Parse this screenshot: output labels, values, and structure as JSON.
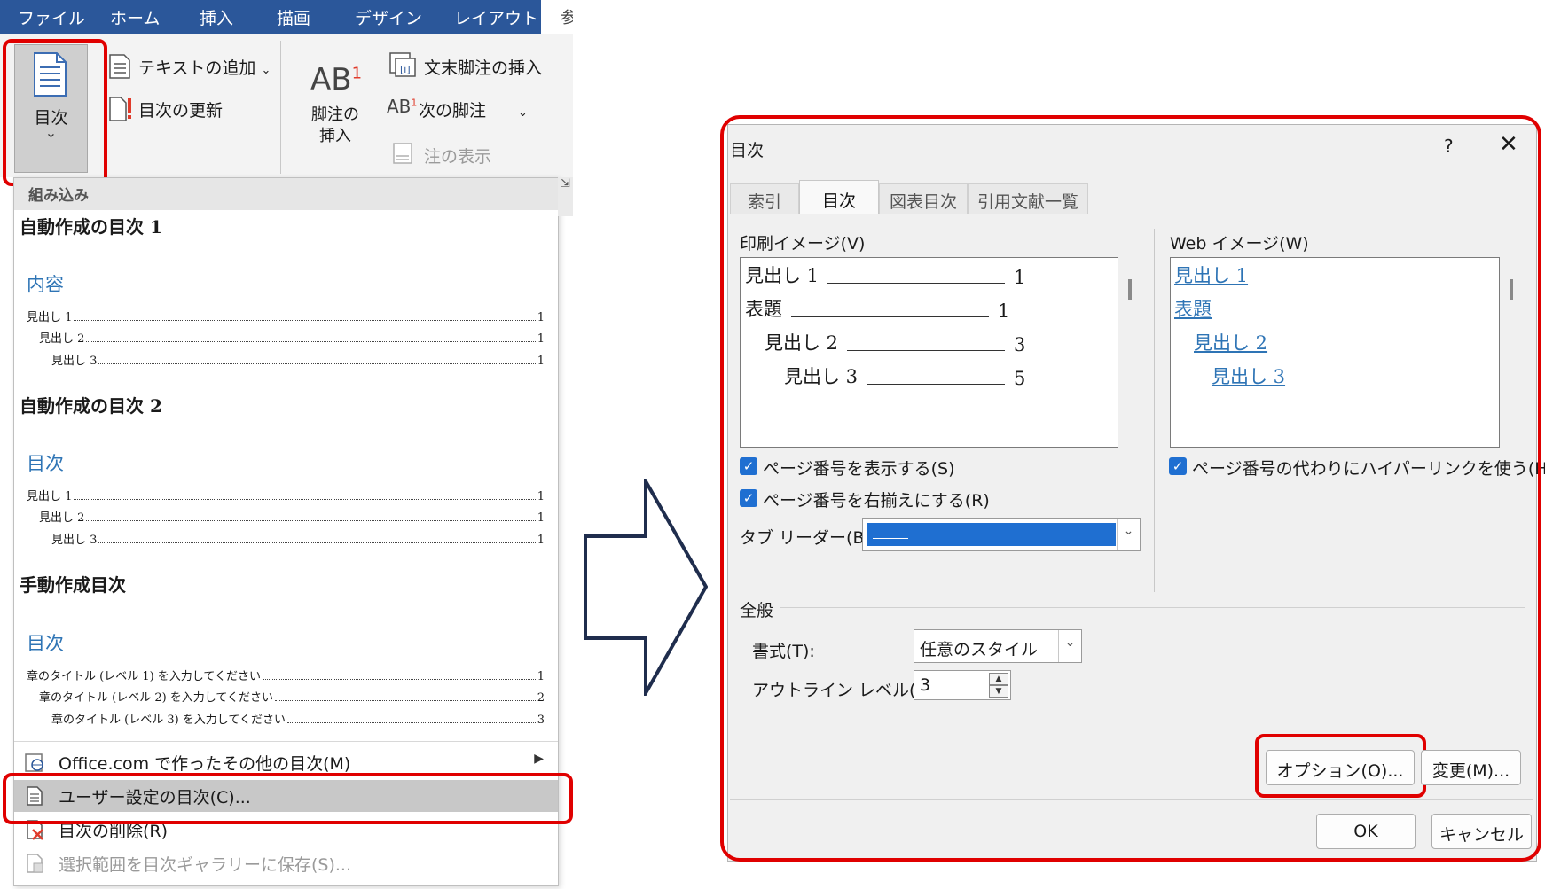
{
  "ribbon": {
    "tabs": [
      "ファイル",
      "ホーム",
      "挿入",
      "描画",
      "デザイン",
      "レイアウト"
    ],
    "tab_cut": "参",
    "toc_button": "目次",
    "add_text": "テキストの追加",
    "update_toc": "目次の更新",
    "insert_footnote_line1": "脚注の",
    "insert_footnote_line2": "挿入",
    "insert_endnote": "文末脚注の挿入",
    "next_footnote": "次の脚注",
    "show_notes": "注の表示",
    "ab_glyph": "AB",
    "ab_sup": "1"
  },
  "gallery": {
    "header": "組み込み",
    "items": [
      {
        "title": "自動作成の目次 1",
        "heading": "内容",
        "lines": [
          {
            "label": "見出し 1",
            "page": "1"
          },
          {
            "label": "見出し 2",
            "page": "1"
          },
          {
            "label": "見出し 3",
            "page": "1"
          }
        ]
      },
      {
        "title": "自動作成の目次 2",
        "heading": "目次",
        "lines": [
          {
            "label": "見出し 1",
            "page": "1"
          },
          {
            "label": "見出し 2",
            "page": "1"
          },
          {
            "label": "見出し 3",
            "page": "1"
          }
        ]
      },
      {
        "title": "手動作成目次",
        "heading": "目次",
        "lines": [
          {
            "label": "章のタイトル (レベル 1) を入力してください",
            "page": "1"
          },
          {
            "label": "章のタイトル (レベル 2) を入力してください",
            "page": "2"
          },
          {
            "label": "章のタイトル (レベル 3) を入力してください",
            "page": "3"
          }
        ]
      }
    ],
    "menu": {
      "more_office": "Office.com で作ったその他の目次(M)",
      "custom_toc": "ユーザー設定の目次(C)...",
      "remove_toc": "目次の削除(R)",
      "save_selection": "選択範囲を目次ギャラリーに保存(S)..."
    }
  },
  "dialog": {
    "title": "目次",
    "help": "?",
    "tabs": [
      "索引",
      "目次",
      "図表目次",
      "引用文献一覧"
    ],
    "active_tab": "目次",
    "print_preview_label": "印刷イメージ(V)",
    "web_preview_label": "Web イメージ(W)",
    "print_preview": [
      {
        "label": "見出し 1",
        "page": "1"
      },
      {
        "label": "表題",
        "page": "1"
      },
      {
        "label": "見出し 2",
        "page": "3"
      },
      {
        "label": "見出し 3",
        "page": "5"
      }
    ],
    "web_preview": [
      "見出し 1",
      "表題",
      "見出し 2",
      "見出し 3"
    ],
    "show_page_numbers": "ページ番号を表示する(S)",
    "right_align": "ページ番号を右揃えにする(R)",
    "tab_leader_label": "タブ リーダー(B):",
    "use_hyperlinks": "ページ番号の代わりにハイパーリンクを使う(H)",
    "general_label": "全般",
    "format_label": "書式(T):",
    "format_value": "任意のスタイル",
    "outline_label": "アウトライン レベル(L):",
    "outline_value": "3",
    "options_button": "オプション(O)...",
    "modify_button": "変更(M)...",
    "ok_button": "OK",
    "cancel_button": "キャンセル",
    "accent": "#1f6fd1"
  },
  "colors": {
    "ribbon_blue": "#2b579a",
    "highlight_red": "#e00000",
    "arrow_navy": "#1f2d4d",
    "link_blue": "#2e74b5"
  }
}
